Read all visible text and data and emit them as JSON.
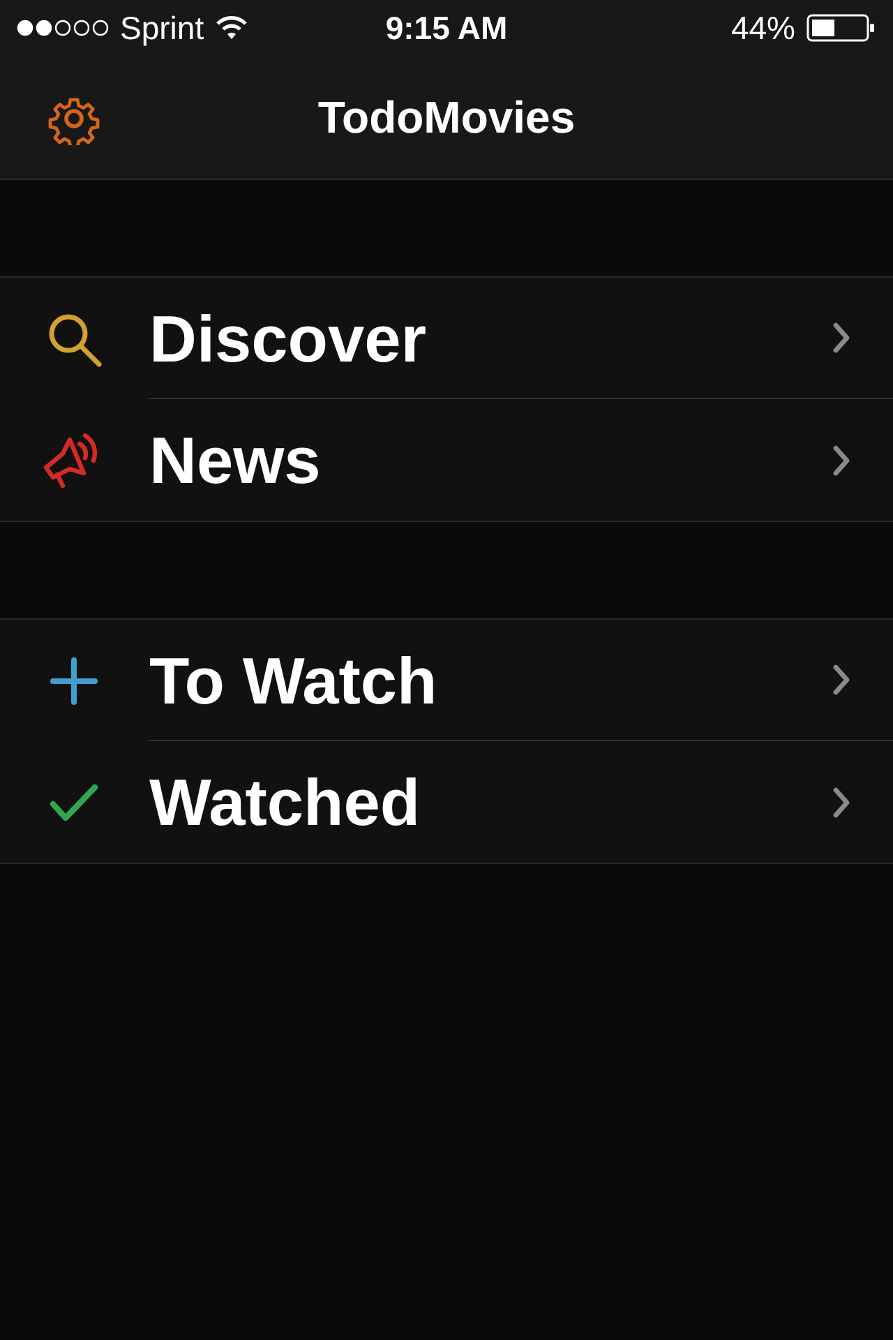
{
  "status_bar": {
    "carrier": "Sprint",
    "time": "9:15 AM",
    "battery": "44%"
  },
  "nav_bar": {
    "title": "TodoMovies"
  },
  "sections": [
    {
      "items": [
        {
          "label": "Discover"
        },
        {
          "label": "News"
        }
      ]
    },
    {
      "items": [
        {
          "label": "To Watch"
        },
        {
          "label": "Watched"
        }
      ]
    }
  ]
}
